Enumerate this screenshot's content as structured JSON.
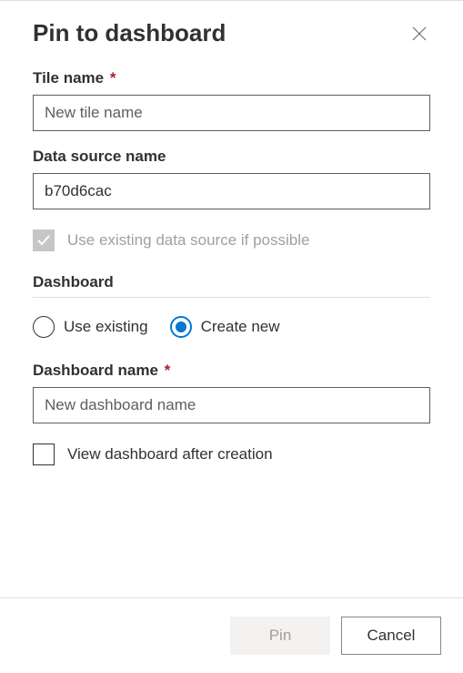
{
  "dialog": {
    "title": "Pin to dashboard"
  },
  "tileName": {
    "label": "Tile name",
    "required": "*",
    "placeholder": "New tile name",
    "value": ""
  },
  "dataSource": {
    "label": "Data source name",
    "value": "b70d6cac"
  },
  "useExistingSource": {
    "label": "Use existing data source if possible"
  },
  "dashboardSection": {
    "label": "Dashboard"
  },
  "radios": {
    "existing": "Use existing",
    "createNew": "Create new"
  },
  "dashboardName": {
    "label": "Dashboard name",
    "required": "*",
    "placeholder": "New dashboard name",
    "value": ""
  },
  "viewAfter": {
    "label": "View dashboard after creation"
  },
  "footer": {
    "pin": "Pin",
    "cancel": "Cancel"
  }
}
